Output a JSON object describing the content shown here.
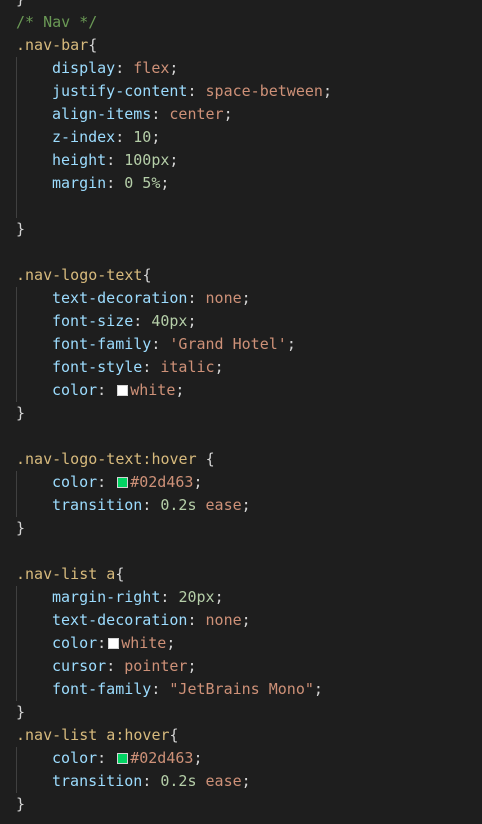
{
  "editor": {
    "lines": [
      {
        "tokens": [
          {
            "t": "}",
            "c": "punct"
          }
        ]
      },
      {
        "tokens": [
          {
            "t": "/* Nav */",
            "c": "comment"
          }
        ]
      },
      {
        "tokens": [
          {
            "t": ".nav-bar",
            "c": "selector"
          },
          {
            "t": "{",
            "c": "punct"
          }
        ]
      },
      {
        "indent": true,
        "tokens": [
          {
            "t": "display",
            "c": "prop"
          },
          {
            "t": ": ",
            "c": "punct"
          },
          {
            "t": "flex",
            "c": "value"
          },
          {
            "t": ";",
            "c": "punct"
          }
        ]
      },
      {
        "indent": true,
        "tokens": [
          {
            "t": "justify-content",
            "c": "prop"
          },
          {
            "t": ": ",
            "c": "punct"
          },
          {
            "t": "space-between",
            "c": "value"
          },
          {
            "t": ";",
            "c": "punct"
          }
        ]
      },
      {
        "indent": true,
        "tokens": [
          {
            "t": "align-items",
            "c": "prop"
          },
          {
            "t": ": ",
            "c": "punct"
          },
          {
            "t": "center",
            "c": "value"
          },
          {
            "t": ";",
            "c": "punct"
          }
        ]
      },
      {
        "indent": true,
        "tokens": [
          {
            "t": "z-index",
            "c": "prop"
          },
          {
            "t": ": ",
            "c": "punct"
          },
          {
            "t": "10",
            "c": "number"
          },
          {
            "t": ";",
            "c": "punct"
          }
        ]
      },
      {
        "indent": true,
        "tokens": [
          {
            "t": "height",
            "c": "prop"
          },
          {
            "t": ": ",
            "c": "punct"
          },
          {
            "t": "100px",
            "c": "number"
          },
          {
            "t": ";",
            "c": "punct"
          }
        ]
      },
      {
        "indent": true,
        "tokens": [
          {
            "t": "margin",
            "c": "prop"
          },
          {
            "t": ": ",
            "c": "punct"
          },
          {
            "t": "0 5%",
            "c": "number"
          },
          {
            "t": ";",
            "c": "punct"
          }
        ]
      },
      {
        "tokens": []
      },
      {
        "tokens": [
          {
            "t": "}",
            "c": "punct"
          }
        ]
      },
      {
        "tokens": []
      },
      {
        "tokens": [
          {
            "t": ".nav-logo-text",
            "c": "selector"
          },
          {
            "t": "{",
            "c": "punct"
          }
        ]
      },
      {
        "indent": true,
        "tokens": [
          {
            "t": "text-decoration",
            "c": "prop"
          },
          {
            "t": ": ",
            "c": "punct"
          },
          {
            "t": "none",
            "c": "value"
          },
          {
            "t": ";",
            "c": "punct"
          }
        ]
      },
      {
        "indent": true,
        "tokens": [
          {
            "t": "font-size",
            "c": "prop"
          },
          {
            "t": ": ",
            "c": "punct"
          },
          {
            "t": "40px",
            "c": "number"
          },
          {
            "t": ";",
            "c": "punct"
          }
        ]
      },
      {
        "indent": true,
        "tokens": [
          {
            "t": "font-family",
            "c": "prop"
          },
          {
            "t": ": ",
            "c": "punct"
          },
          {
            "t": "'Grand Hotel'",
            "c": "value"
          },
          {
            "t": ";",
            "c": "punct"
          }
        ]
      },
      {
        "indent": true,
        "tokens": [
          {
            "t": "font-style",
            "c": "prop"
          },
          {
            "t": ": ",
            "c": "punct"
          },
          {
            "t": "italic",
            "c": "value"
          },
          {
            "t": ";",
            "c": "punct"
          }
        ]
      },
      {
        "indent": true,
        "tokens": [
          {
            "t": "color",
            "c": "prop"
          },
          {
            "t": ": ",
            "c": "punct"
          },
          {
            "swatch": "#ffffff"
          },
          {
            "t": "white",
            "c": "value"
          },
          {
            "t": ";",
            "c": "punct"
          }
        ]
      },
      {
        "tokens": [
          {
            "t": "}",
            "c": "punct"
          }
        ]
      },
      {
        "tokens": []
      },
      {
        "tokens": [
          {
            "t": ".nav-logo-text:hover",
            "c": "selector"
          },
          {
            "t": " {",
            "c": "punct"
          }
        ]
      },
      {
        "indent": true,
        "tokens": [
          {
            "t": "color",
            "c": "prop"
          },
          {
            "t": ": ",
            "c": "punct"
          },
          {
            "swatch": "#02d463"
          },
          {
            "t": "#02d463",
            "c": "value"
          },
          {
            "t": ";",
            "c": "punct"
          }
        ]
      },
      {
        "indent": true,
        "tokens": [
          {
            "t": "transition",
            "c": "prop"
          },
          {
            "t": ": ",
            "c": "punct"
          },
          {
            "t": "0.2s",
            "c": "number"
          },
          {
            "t": " ",
            "c": "punct"
          },
          {
            "t": "ease",
            "c": "value"
          },
          {
            "t": ";",
            "c": "punct"
          }
        ]
      },
      {
        "tokens": [
          {
            "t": "}",
            "c": "punct"
          }
        ]
      },
      {
        "tokens": []
      },
      {
        "tokens": [
          {
            "t": ".nav-list a",
            "c": "selector"
          },
          {
            "t": "{",
            "c": "punct"
          }
        ]
      },
      {
        "indent": true,
        "tokens": [
          {
            "t": "margin-right",
            "c": "prop"
          },
          {
            "t": ": ",
            "c": "punct"
          },
          {
            "t": "20px",
            "c": "number"
          },
          {
            "t": ";",
            "c": "punct"
          }
        ]
      },
      {
        "indent": true,
        "tokens": [
          {
            "t": "text-decoration",
            "c": "prop"
          },
          {
            "t": ": ",
            "c": "punct"
          },
          {
            "t": "none",
            "c": "value"
          },
          {
            "t": ";",
            "c": "punct"
          }
        ]
      },
      {
        "indent": true,
        "tokens": [
          {
            "t": "color",
            "c": "prop"
          },
          {
            "t": ":",
            "c": "punct"
          },
          {
            "swatch": "#ffffff"
          },
          {
            "t": "white",
            "c": "value"
          },
          {
            "t": ";",
            "c": "punct"
          }
        ]
      },
      {
        "indent": true,
        "tokens": [
          {
            "t": "cursor",
            "c": "prop"
          },
          {
            "t": ": ",
            "c": "punct"
          },
          {
            "t": "pointer",
            "c": "value"
          },
          {
            "t": ";",
            "c": "punct"
          }
        ]
      },
      {
        "indent": true,
        "tokens": [
          {
            "t": "font-family",
            "c": "prop"
          },
          {
            "t": ": ",
            "c": "punct"
          },
          {
            "t": "\"JetBrains Mono\"",
            "c": "value"
          },
          {
            "t": ";",
            "c": "punct"
          }
        ]
      },
      {
        "tokens": [
          {
            "t": "}",
            "c": "punct"
          }
        ]
      },
      {
        "tokens": [
          {
            "t": ".nav-list a:hover",
            "c": "selector"
          },
          {
            "t": "{",
            "c": "punct"
          }
        ]
      },
      {
        "indent": true,
        "tokens": [
          {
            "t": "color",
            "c": "prop"
          },
          {
            "t": ": ",
            "c": "punct"
          },
          {
            "swatch": "#02d463"
          },
          {
            "t": "#02d463",
            "c": "value"
          },
          {
            "t": ";",
            "c": "punct"
          }
        ]
      },
      {
        "indent": true,
        "tokens": [
          {
            "t": "transition",
            "c": "prop"
          },
          {
            "t": ": ",
            "c": "punct"
          },
          {
            "t": "0.2s",
            "c": "number"
          },
          {
            "t": " ",
            "c": "punct"
          },
          {
            "t": "ease",
            "c": "value"
          },
          {
            "t": ";",
            "c": "punct"
          }
        ]
      },
      {
        "tokens": [
          {
            "t": "}",
            "c": "punct"
          }
        ]
      }
    ]
  },
  "colors": {
    "background": "#1e1e1e",
    "comment": "#6a9955",
    "selector": "#d7ba7d",
    "property": "#9cdcfe",
    "value": "#ce9178",
    "number": "#b5cea8",
    "punctuation": "#d4d4d4"
  }
}
